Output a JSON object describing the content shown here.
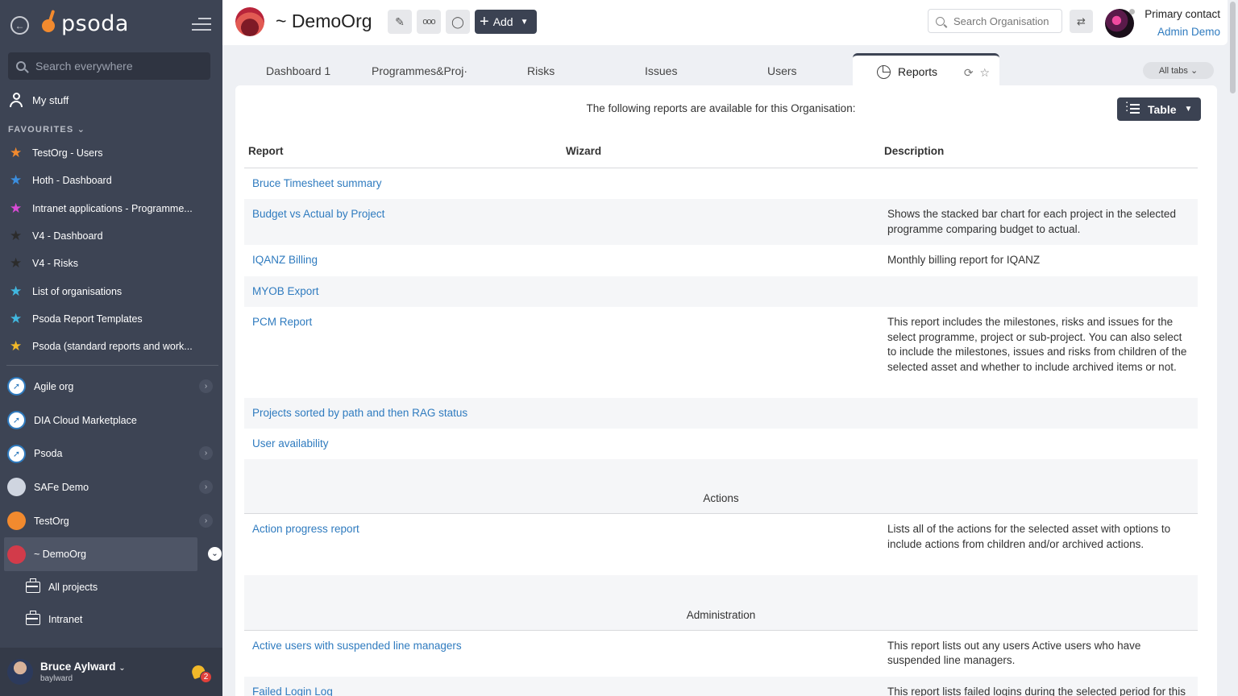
{
  "sidebar": {
    "logo_text": "psoda",
    "search_placeholder": "Search everywhere",
    "mystuff_label": "My stuff",
    "favourites_heading": "FAVOURITES",
    "favourites": [
      {
        "label": "TestOrg - Users",
        "star_color": "#f28a2e"
      },
      {
        "label": "Hoth - Dashboard",
        "star_color": "#3b8fe0"
      },
      {
        "label": "Intranet applications - Programme...",
        "star_color": "#d94bd6"
      },
      {
        "label": "V4 - Dashboard",
        "star_color": "#2c2c2c"
      },
      {
        "label": "V4 - Risks",
        "star_color": "#2c2c2c"
      },
      {
        "label": "List of organisations",
        "star_color": "#41b8e0"
      },
      {
        "label": "Psoda Report Templates",
        "star_color": "#41b8e0"
      },
      {
        "label": "Psoda (standard reports and work...",
        "star_color": "#f1b829"
      }
    ],
    "orgs": [
      {
        "label": "Agile org",
        "icon_color": "#2f7bbf",
        "has_children": true
      },
      {
        "label": "DIA Cloud Marketplace",
        "icon_color": "#2f7bbf",
        "has_children": false
      },
      {
        "label": "Psoda",
        "icon_color": "#2f7bbf",
        "has_children": true
      },
      {
        "label": "SAFe Demo",
        "icon_color": "#cfd5e0",
        "has_children": true
      },
      {
        "label": "TestOrg",
        "icon_color": "#f28a2e",
        "has_children": true
      },
      {
        "label": "~ DemoOrg",
        "icon_color": "#d23b4a",
        "has_children": true,
        "active": true
      }
    ],
    "sub_items": [
      {
        "label": "All projects"
      },
      {
        "label": "Intranet"
      }
    ],
    "user": {
      "name": "Bruce Aylward",
      "handle": "baylward",
      "notifications": "2"
    }
  },
  "header": {
    "title": "~ DemoOrg",
    "add_label": "Add",
    "search_placeholder": "Search Organisation",
    "primary_contact_label": "Primary contact",
    "primary_contact_name": "Admin Demo"
  },
  "tabs": {
    "items": [
      "Dashboard 1",
      "Programmes&Proj·",
      "Risks",
      "Issues",
      "Users"
    ],
    "active": "Reports",
    "all_tabs_label": "All tabs"
  },
  "content": {
    "intro": "The following reports are available for this Organisation:",
    "view_label": "Table",
    "columns": [
      "Report",
      "Wizard",
      "Description"
    ],
    "reports": [
      {
        "name": "Bruce Timesheet summary",
        "desc": ""
      },
      {
        "name": "Budget vs Actual by Project",
        "desc": "Shows the stacked bar chart for each project in the selected programme comparing budget to actual."
      },
      {
        "name": "IQANZ Billing",
        "desc": "Monthly billing report for IQANZ"
      },
      {
        "name": "MYOB Export",
        "desc": ""
      },
      {
        "name": "PCM Report",
        "desc": "This report includes the milestones, risks and issues for the select programme, project or sub-project. You can also select to include the milestones, issues and risks from children of the selected asset and whether to include archived items or not."
      },
      {
        "name": "Projects sorted by path and then RAG status",
        "desc": ""
      },
      {
        "name": "User availability",
        "desc": ""
      }
    ],
    "groups": [
      {
        "label": "Actions",
        "reports": [
          {
            "name": "Action progress report",
            "desc": "Lists all of the actions for the selected asset with options to include actions from children and/or archived actions."
          }
        ]
      },
      {
        "label": "Administration",
        "reports": [
          {
            "name": "Active users with suspended line managers",
            "desc": "This report lists out any users Active users who have suspended line managers."
          },
          {
            "name": "Failed Login Log",
            "desc": "This report lists failed logins during the selected period for this organisation's usernames."
          }
        ]
      }
    ]
  }
}
